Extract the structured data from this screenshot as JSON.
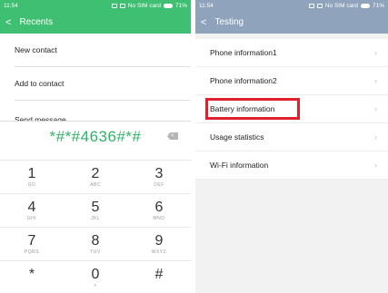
{
  "left": {
    "status": {
      "time": "11:54",
      "sim": "No SIM card",
      "battery": "71%"
    },
    "appbar": {
      "back": "<",
      "title": "Recents"
    },
    "menu": [
      "New contact",
      "Add to contact",
      "Send message"
    ],
    "dial": {
      "value": "*#*#4636#*#",
      "delete": "×"
    },
    "keys": [
      [
        {
          "d": "1",
          "l": "GD"
        },
        {
          "d": "2",
          "l": "ABC"
        },
        {
          "d": "3",
          "l": "DEF"
        }
      ],
      [
        {
          "d": "4",
          "l": "GHI"
        },
        {
          "d": "5",
          "l": "JKL"
        },
        {
          "d": "6",
          "l": "MNO"
        }
      ],
      [
        {
          "d": "7",
          "l": "PQRS"
        },
        {
          "d": "8",
          "l": "TUV"
        },
        {
          "d": "9",
          "l": "WXYZ"
        }
      ],
      [
        {
          "d": "*",
          "l": ""
        },
        {
          "d": "0",
          "l": "+"
        },
        {
          "d": "#",
          "l": ""
        }
      ]
    ]
  },
  "right": {
    "status": {
      "time": "11:54",
      "sim": "No SIM card",
      "battery": "71%"
    },
    "appbar": {
      "back": "<",
      "title": "Testing"
    },
    "items": [
      "Phone information1",
      "Phone information2",
      "Battery information",
      "Usage statistics",
      "Wi-Fi information"
    ],
    "highlight_color": "#e0202c"
  },
  "colors": {
    "green": "#3fbf72",
    "slate": "#8fa3bc",
    "digits_green": "#2fb366"
  }
}
